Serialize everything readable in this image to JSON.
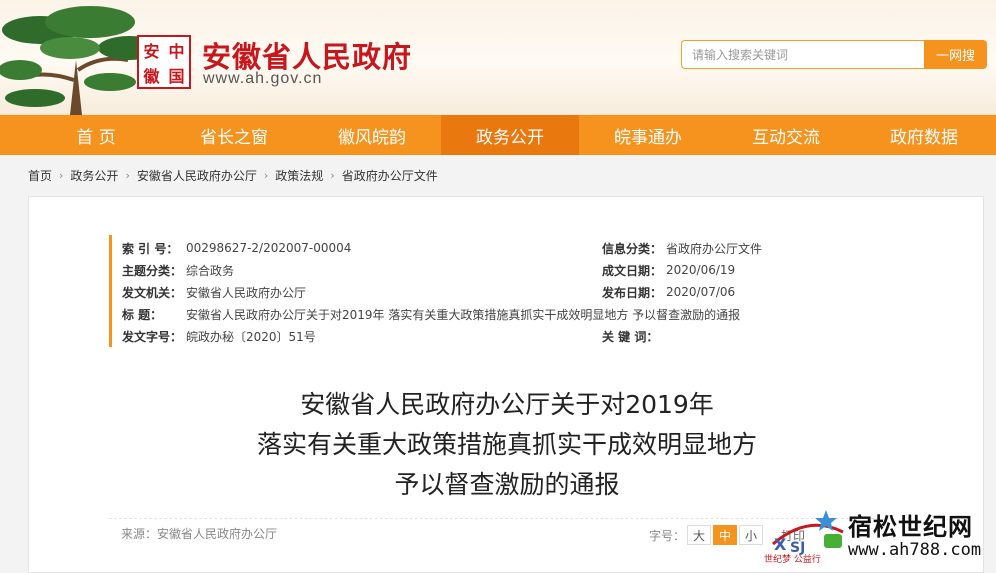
{
  "header": {
    "seal_chars": [
      "安",
      "中",
      "徽",
      "国"
    ],
    "site_name": "安徽省人民政府",
    "site_url": "www.ah.gov.cn",
    "search_placeholder": "请输入搜索关键词",
    "search_button": "一网搜"
  },
  "nav": {
    "items": [
      "首 页",
      "省长之窗",
      "徽风皖韵",
      "政务公开",
      "皖事通办",
      "互动交流",
      "政府数据"
    ],
    "active": "政务公开"
  },
  "breadcrumb": [
    "首页",
    "政务公开",
    "安徽省人民政府办公厅",
    "政策法规",
    "省政府办公厅文件"
  ],
  "meta": {
    "index_label": "索 引 号：",
    "index_value": "00298627-2/202007-00004",
    "info_cat_label": "信息分类：",
    "info_cat_value": "省政府办公厅文件",
    "topic_label": "主题分类：",
    "topic_value": "综合政务",
    "written_label": "成文日期：",
    "written_value": "2020/06/19",
    "issuer_label": "发文机关：",
    "issuer_value": "安徽省人民政府办公厅",
    "publish_label": "发布日期：",
    "publish_value": "2020/07/06",
    "title_label": "标 题：",
    "title_value": "安徽省人民政府办公厅关于对2019年 落实有关重大政策措施真抓实干成效明显地方 予以督查激励的通报",
    "docno_label": "发文字号：",
    "docno_value": "皖政办秘〔2020〕51号",
    "keywords_label": "关 键 词："
  },
  "article": {
    "title_lines": [
      "安徽省人民政府办公厅关于对2019年",
      "落实有关重大政策措施真抓实干成效明显地方",
      "予以督查激励的通报"
    ],
    "source": "来源：安徽省人民政府办公厅",
    "fontsize_label": "字号：",
    "fontsize_options": [
      "大",
      "中",
      "小"
    ],
    "print_label": "打印"
  },
  "watermark": {
    "name": "宿松世纪网",
    "url": "www.ah788.com",
    "tagline": "世纪梦 公益行"
  },
  "colors": {
    "accent": "#f5931e",
    "nav_active": "#e9780f",
    "brand_red": "#c8161d"
  }
}
